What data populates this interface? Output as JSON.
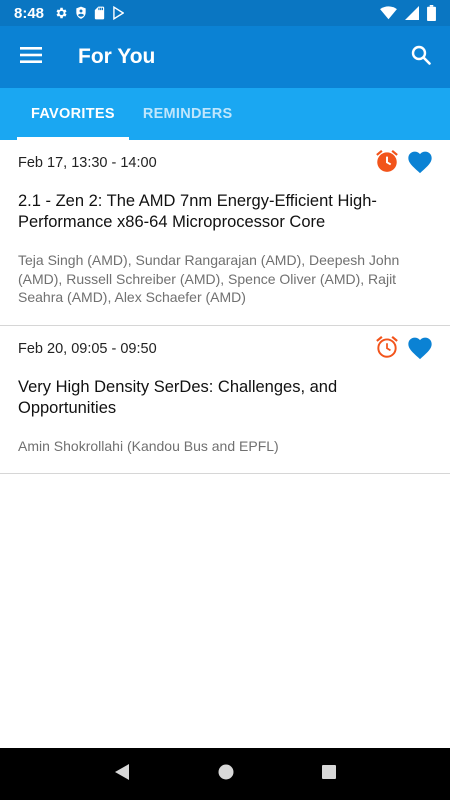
{
  "status_bar": {
    "time": "8:48",
    "left_icons": [
      "gear-icon",
      "shield-icon",
      "sd-card-icon",
      "play-store-icon"
    ],
    "right_icons": [
      "wifi-icon",
      "signal-icon",
      "battery-icon"
    ]
  },
  "app_bar": {
    "title": "For You",
    "menu_icon": "hamburger-menu-icon",
    "search_icon": "search-icon"
  },
  "tabs": [
    {
      "label": "FAVORITES",
      "selected": true
    },
    {
      "label": "REMINDERS",
      "selected": false
    }
  ],
  "sessions": [
    {
      "time": "Feb 17, 13:30 - 14:00",
      "title": "2.1 - Zen 2: The AMD 7nm Energy-Efficient High-Performance x86-64 Microprocessor Core",
      "authors": "Teja Singh (AMD), Sundar Rangarajan (AMD), Deepesh John (AMD), Russell Schreiber (AMD), Spence Oliver (AMD), Rajit Seahra (AMD), Alex Schaefer (AMD)",
      "reminder_set": true,
      "favorite": true
    },
    {
      "time": "Feb 20, 09:05 - 09:50",
      "title": "Very High Density SerDes: Challenges, and Opportunities",
      "authors": "Amin Shokrollahi (Kandou Bus and EPFL)",
      "reminder_set": false,
      "favorite": true
    }
  ],
  "colors": {
    "status_bar": "#0a76c2",
    "app_bar": "#0b82d4",
    "tab_bar": "#1aa7f2",
    "alarm": "#f2541b",
    "heart": "#0b82d4"
  },
  "nav_bar": {
    "buttons": [
      "back-icon",
      "home-icon",
      "recents-icon"
    ]
  }
}
